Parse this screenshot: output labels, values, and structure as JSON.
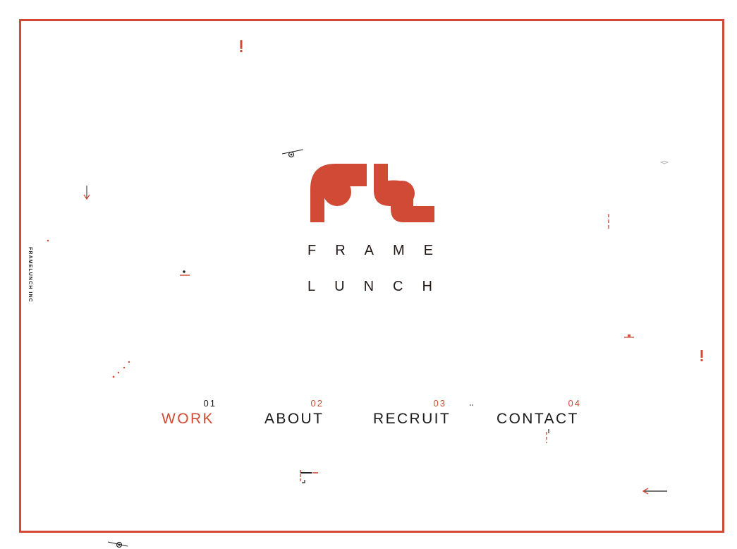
{
  "company": "FRAMELUNCH INC",
  "brand": {
    "line1": "FRAME",
    "line2": "LUNCH",
    "color": "#d14a35",
    "text_color": "#231815"
  },
  "nav": [
    {
      "num": "01",
      "label": "WORK",
      "active": true
    },
    {
      "num": "02",
      "label": "ABOUT",
      "active": false
    },
    {
      "num": "03",
      "label": "RECRUIT",
      "active": false
    },
    {
      "num": "04",
      "label": "CONTACT",
      "active": false
    }
  ],
  "icons": [
    "exclamation-icon",
    "arrow-down-icon",
    "arrow-left-icon",
    "eye-icon",
    "dashed-line-icon",
    "corner-bracket-icon"
  ]
}
